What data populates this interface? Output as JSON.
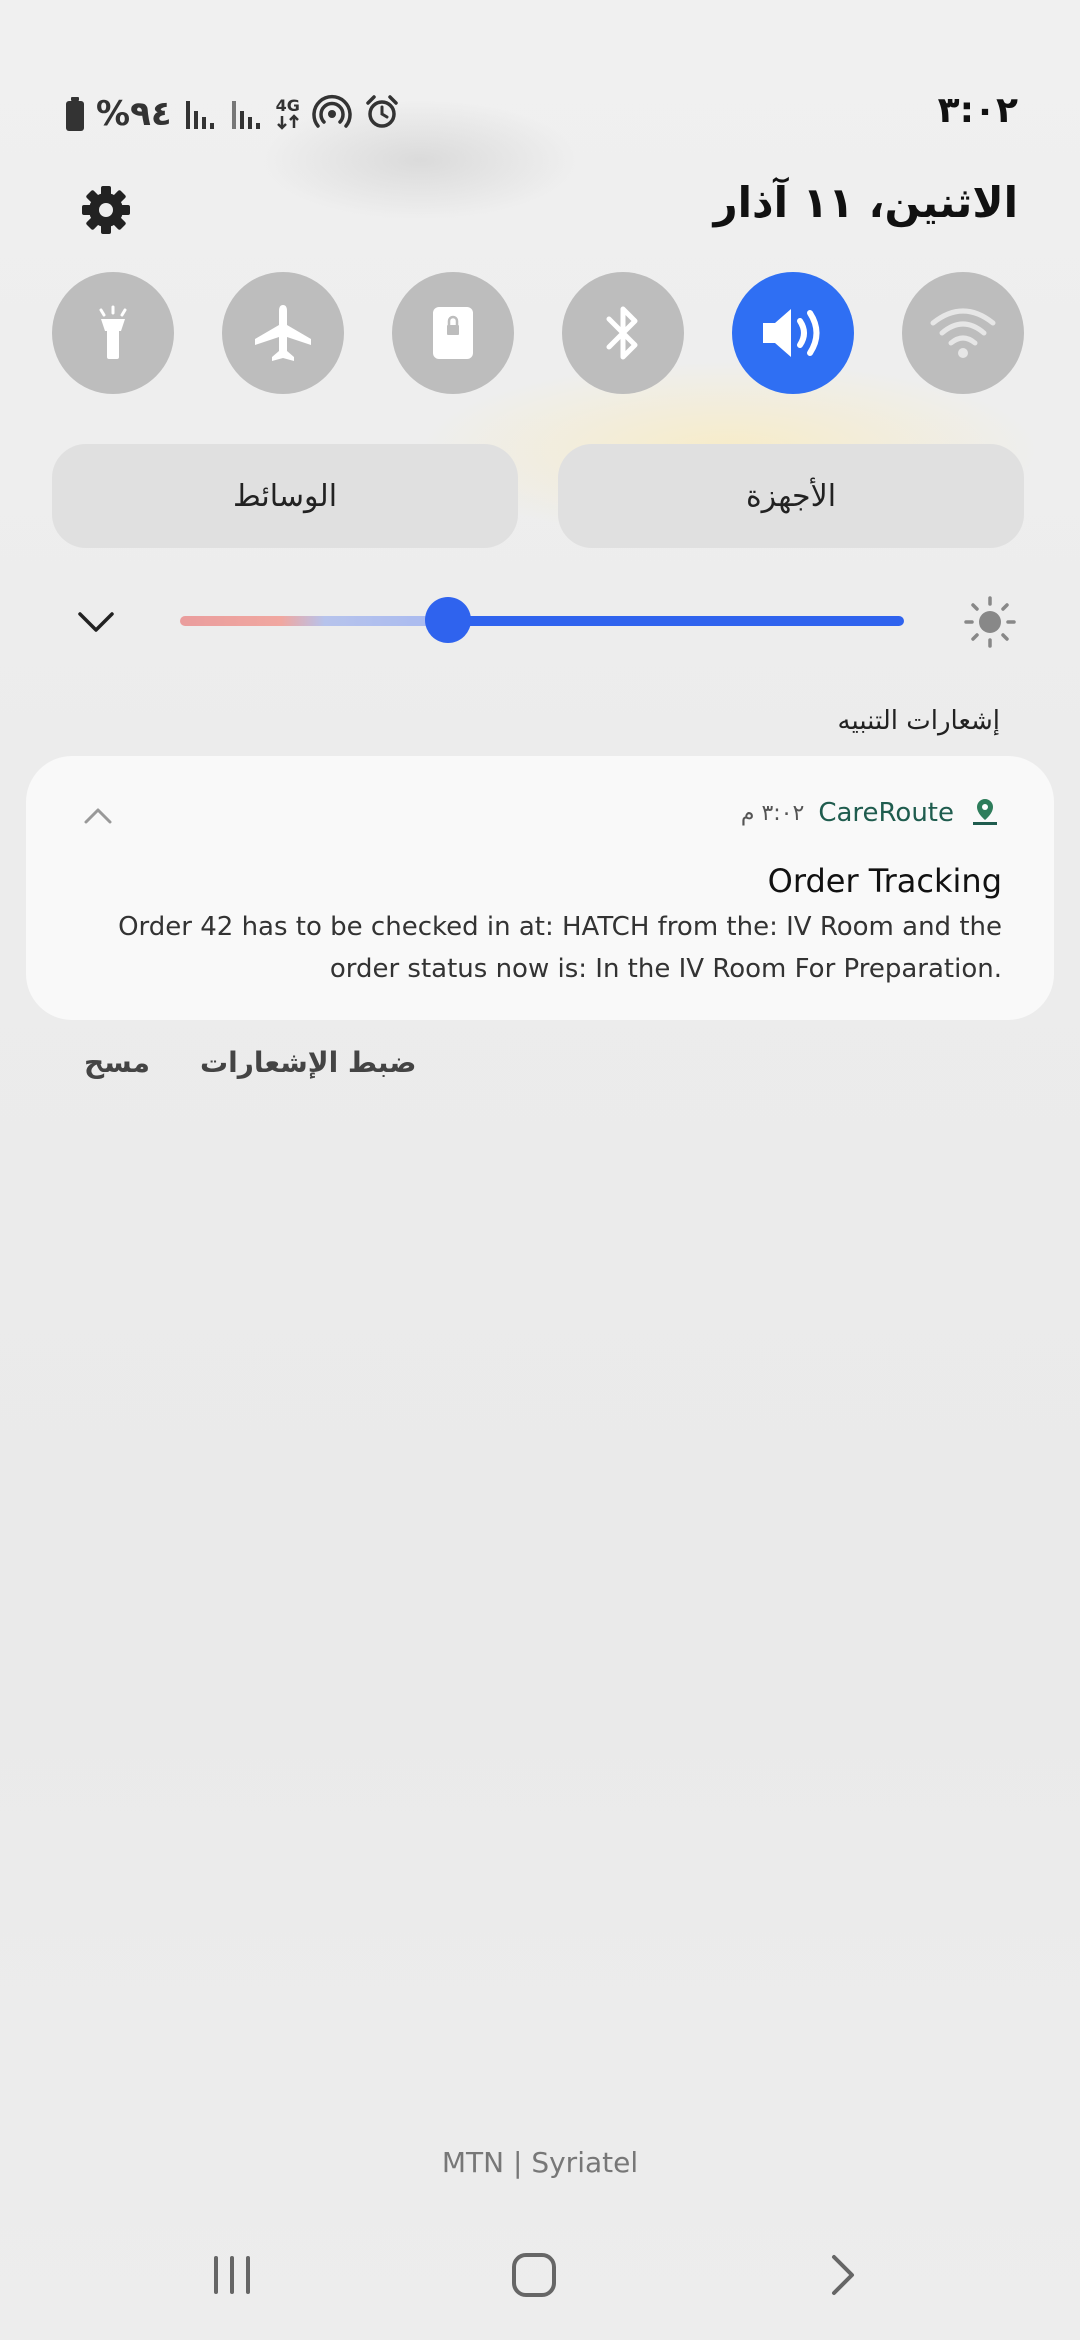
{
  "status_bar": {
    "time": "٣:٠٢",
    "battery_text": "%٩٤",
    "network_label": "4G",
    "icons": [
      "battery-icon",
      "signal-icon",
      "signal-icon",
      "4g-data-icon",
      "hotspot-icon",
      "alarm-icon"
    ]
  },
  "header": {
    "date": "الاثنين، ١١ آذار",
    "settings_icon": "gear-icon"
  },
  "quick_toggles": [
    {
      "name": "wifi",
      "icon": "wifi-icon",
      "active": false
    },
    {
      "name": "sound",
      "icon": "speaker-icon",
      "active": true
    },
    {
      "name": "bluetooth",
      "icon": "bluetooth-icon",
      "active": false
    },
    {
      "name": "rotation-lock",
      "icon": "lock-icon",
      "active": false
    },
    {
      "name": "airplane-mode",
      "icon": "airplane-icon",
      "active": false
    },
    {
      "name": "flashlight",
      "icon": "flashlight-icon",
      "active": false
    }
  ],
  "pills": {
    "devices": "الأجهزة",
    "media": "الوسائط"
  },
  "brightness": {
    "level": 0.37,
    "accent": "#2f63ee"
  },
  "notifications": {
    "section_title": "إشعارات التنبيه",
    "items": [
      {
        "app": "CareRoute",
        "time": "٣:٠٢ م",
        "title": "Order Tracking",
        "body": "Order 42 has to be checked in at: HATCH from the: IV Room and the order status now is: In the IV Room For Preparation."
      }
    ],
    "settings_label": "ضبط الإشعارات",
    "clear_label": "مسح"
  },
  "carrier": "MTN | Syriatel",
  "colors": {
    "toggle_active": "#2f6ff3",
    "toggle_inactive": "#bdbdbd",
    "app_name": "#1f5c4e"
  }
}
